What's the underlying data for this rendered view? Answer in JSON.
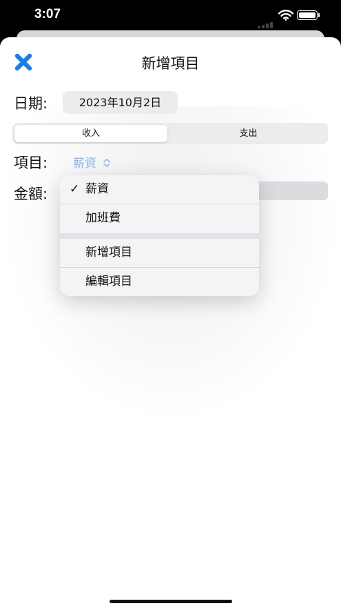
{
  "status": {
    "time": "3:07"
  },
  "header": {
    "title": "新增項目",
    "close_icon": "close-x-icon",
    "accent": "#1a7fe0"
  },
  "form": {
    "date_label": "日期:",
    "date_value": "2023年10月2日",
    "type_segments": [
      "收入",
      "支出"
    ],
    "selected_segment": "收入",
    "item_label": "項目:",
    "item_value": "薪資",
    "amount_label": "金額:"
  },
  "menu": {
    "items": [
      "薪資",
      "加班費"
    ],
    "selected": "薪資",
    "check": "✓",
    "actions": [
      "新增項目",
      "編輯項目"
    ]
  }
}
